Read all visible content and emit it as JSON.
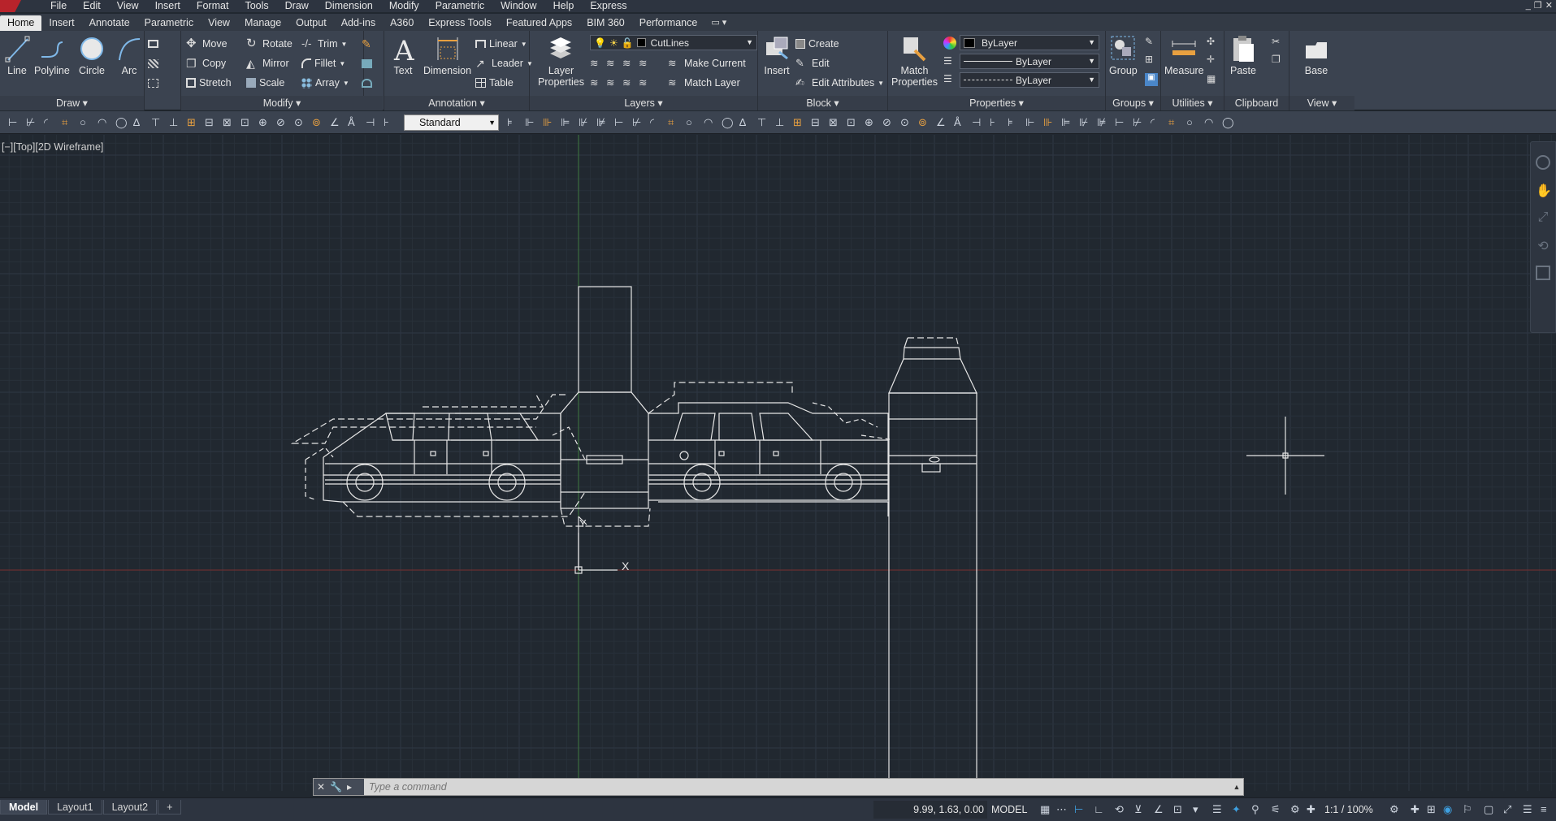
{
  "menubar": {
    "items": [
      "File",
      "Edit",
      "View",
      "Insert",
      "Format",
      "Tools",
      "Draw",
      "Dimension",
      "Modify",
      "Parametric",
      "Window",
      "Help",
      "Express"
    ],
    "controls": [
      "_",
      "❐",
      "✕"
    ]
  },
  "ribbon_tabs": [
    "Home",
    "Insert",
    "Annotate",
    "Parametric",
    "View",
    "Manage",
    "Output",
    "Add-ins",
    "A360",
    "Express Tools",
    "Featured Apps",
    "BIM 360",
    "Performance"
  ],
  "tab_options_glyph": "▭ ▾",
  "panels": {
    "draw": {
      "title": "Draw ▾",
      "line": "Line",
      "polyline": "Polyline",
      "circle": "Circle",
      "arc": "Arc"
    },
    "modify": {
      "title": "Modify ▾",
      "move": "Move",
      "rotate": "Rotate",
      "trim": "Trim",
      "copy": "Copy",
      "mirror": "Mirror",
      "fillet": "Fillet",
      "stretch": "Stretch",
      "scale": "Scale",
      "array": "Array"
    },
    "annotation": {
      "title": "Annotation ▾",
      "text": "Text",
      "dimension": "Dimension",
      "linear": "Linear",
      "leader": "Leader",
      "table": "Table"
    },
    "layers": {
      "title": "Layers ▾",
      "layer_properties_1": "Layer",
      "layer_properties_2": "Properties",
      "current_layer": "CutLines",
      "make_current": "Make Current",
      "match_layer": "Match Layer"
    },
    "block": {
      "title": "Block ▾",
      "insert": "Insert",
      "create": "Create",
      "edit": "Edit",
      "edit_attributes": "Edit Attributes"
    },
    "properties": {
      "title": "Properties ▾",
      "match_1": "Match",
      "match_2": "Properties",
      "color": "ByLayer",
      "linetype": "ByLayer",
      "lineweight": "ByLayer"
    },
    "groups": {
      "title": "Groups ▾",
      "group": "Group"
    },
    "utilities": {
      "title": "Utilities ▾",
      "measure": "Measure"
    },
    "clipboard": {
      "title": "Clipboard",
      "paste": "Paste"
    },
    "view": {
      "title": "View ▾",
      "base": "Base"
    }
  },
  "toolbar2": {
    "text_style": "Standard"
  },
  "canvas": {
    "viewport_label": "[−][Top][2D Wireframe]",
    "ucs_y": "Y",
    "ucs_x": "X"
  },
  "command": {
    "placeholder": "Type a command"
  },
  "status": {
    "layout_tabs": [
      "Model",
      "Layout1",
      "Layout2"
    ],
    "add_layout": "+",
    "coords": "9.99, 1.63, 0.00",
    "model": "MODEL",
    "annotation_scale": "1:1 / 100%"
  },
  "colors": {
    "background": "#212830",
    "ribbon": "#3b4350",
    "grid_minor": "#28303a",
    "grid_major": "#2e3744",
    "y_axis": "#3f7a3f",
    "x_axis": "#7a2f2f",
    "geometry": "#e6e6e6",
    "accent": "#3ea0e0"
  }
}
